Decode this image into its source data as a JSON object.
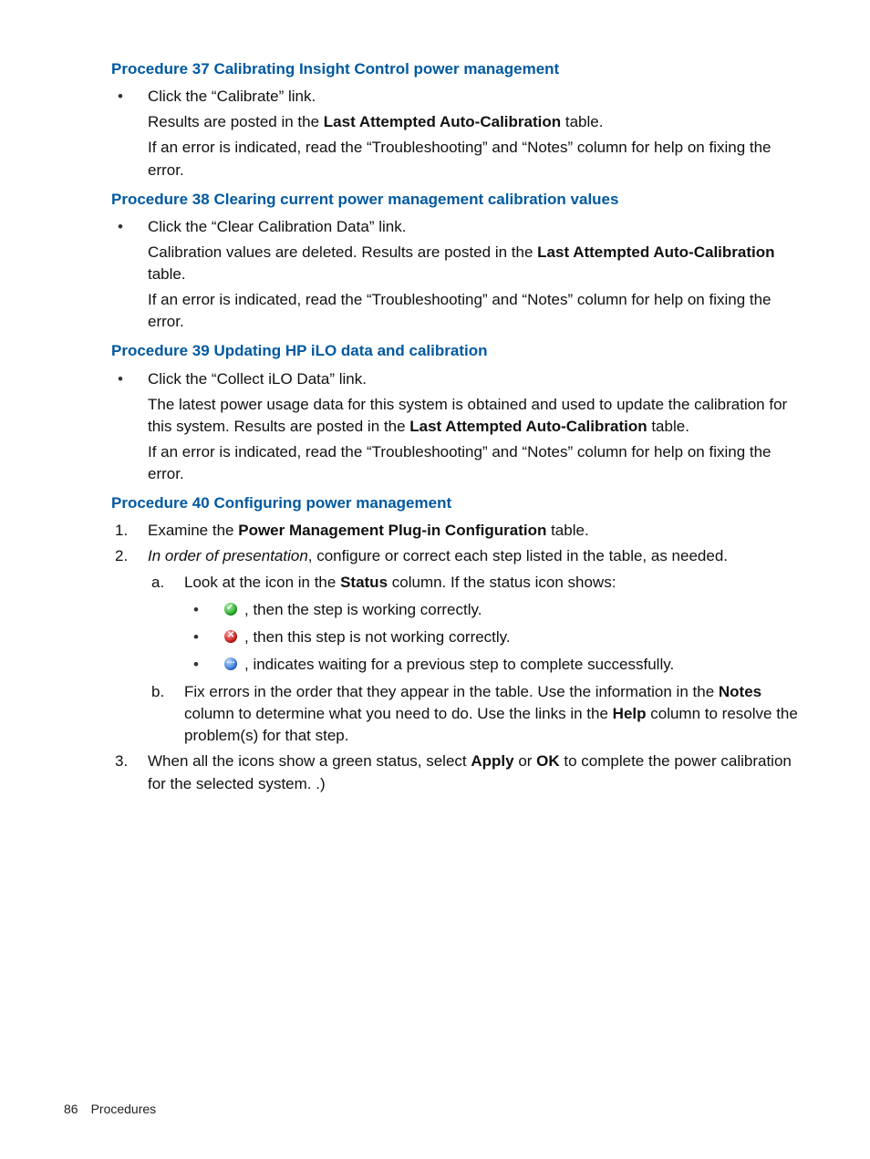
{
  "procedures": [
    {
      "title": "Procedure 37 Calibrating Insight Control power management",
      "click": "Click the “Calibrate” link.",
      "result_pre": "Results are posted in the ",
      "result_bold": "Last Attempted Auto-Calibration",
      "result_post": " table.",
      "error_note": "If an error is indicated, read the “Troubleshooting” and “Notes” column for help on fixing the error."
    },
    {
      "title": "Procedure 38 Clearing current power management calibration values",
      "click": "Click the “Clear Calibration Data” link.",
      "result_pre": "Calibration values are deleted. Results are posted in the ",
      "result_bold": "Last Attempted Auto-Calibration",
      "result_post": " table.",
      "error_note": "If an error is indicated, read the “Troubleshooting” and “Notes” column for help on fixing the error."
    },
    {
      "title": "Procedure 39 Updating HP iLO data and calibration",
      "click": "Click the “Collect iLO Data” link.",
      "result_pre": "The latest power usage data for this system is obtained and used to update the calibration for this system. Results are posted in the ",
      "result_bold": "Last Attempted Auto-Calibration",
      "result_post": " table.",
      "error_note": "If an error is indicated, read the “Troubleshooting” and “Notes” column for help on fixing the error."
    }
  ],
  "proc40": {
    "title": "Procedure 40 Configuring power management",
    "step1_pre": "Examine the ",
    "step1_bold": "Power Management Plug-in Configuration",
    "step1_post": " table.",
    "step2_italic": "In order of presentation",
    "step2_rest": ", configure or correct each step listed in the table, as needed.",
    "step2a_pre": "Look at the icon in the ",
    "step2a_bold": "Status",
    "step2a_post": " column. If the status icon shows:",
    "icon_ok": ", then the step is working correctly.",
    "icon_err": ", then this step is not working correctly.",
    "icon_wait": ", indicates waiting for a previous step to complete successfully.",
    "step2b_pre": "Fix errors in the order that they appear in the table. Use the information in the ",
    "step2b_bold1": "Notes",
    "step2b_mid": " column to determine what you need to do. Use the links in the ",
    "step2b_bold2": "Help",
    "step2b_post": " column to resolve the problem(s) for that step.",
    "step3_pre": "When all the icons show a green status, select ",
    "step3_bold1": "Apply",
    "step3_mid": " or ",
    "step3_bold2": "OK",
    "step3_post": " to complete the power calibration for the selected system. .)"
  },
  "footer": {
    "page": "86",
    "section": "Procedures"
  }
}
